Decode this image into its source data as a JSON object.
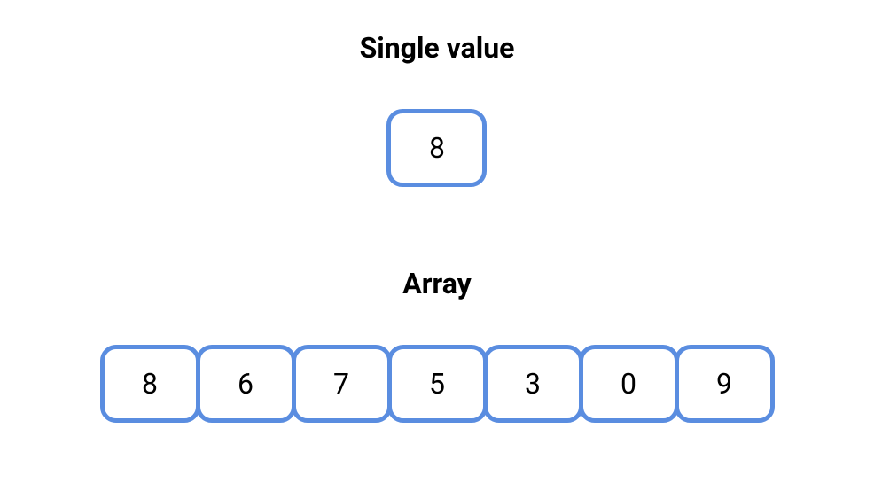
{
  "single": {
    "title": "Single value",
    "value": "8"
  },
  "array": {
    "title": "Array",
    "values": [
      "8",
      "6",
      "7",
      "5",
      "3",
      "0",
      "9"
    ]
  }
}
